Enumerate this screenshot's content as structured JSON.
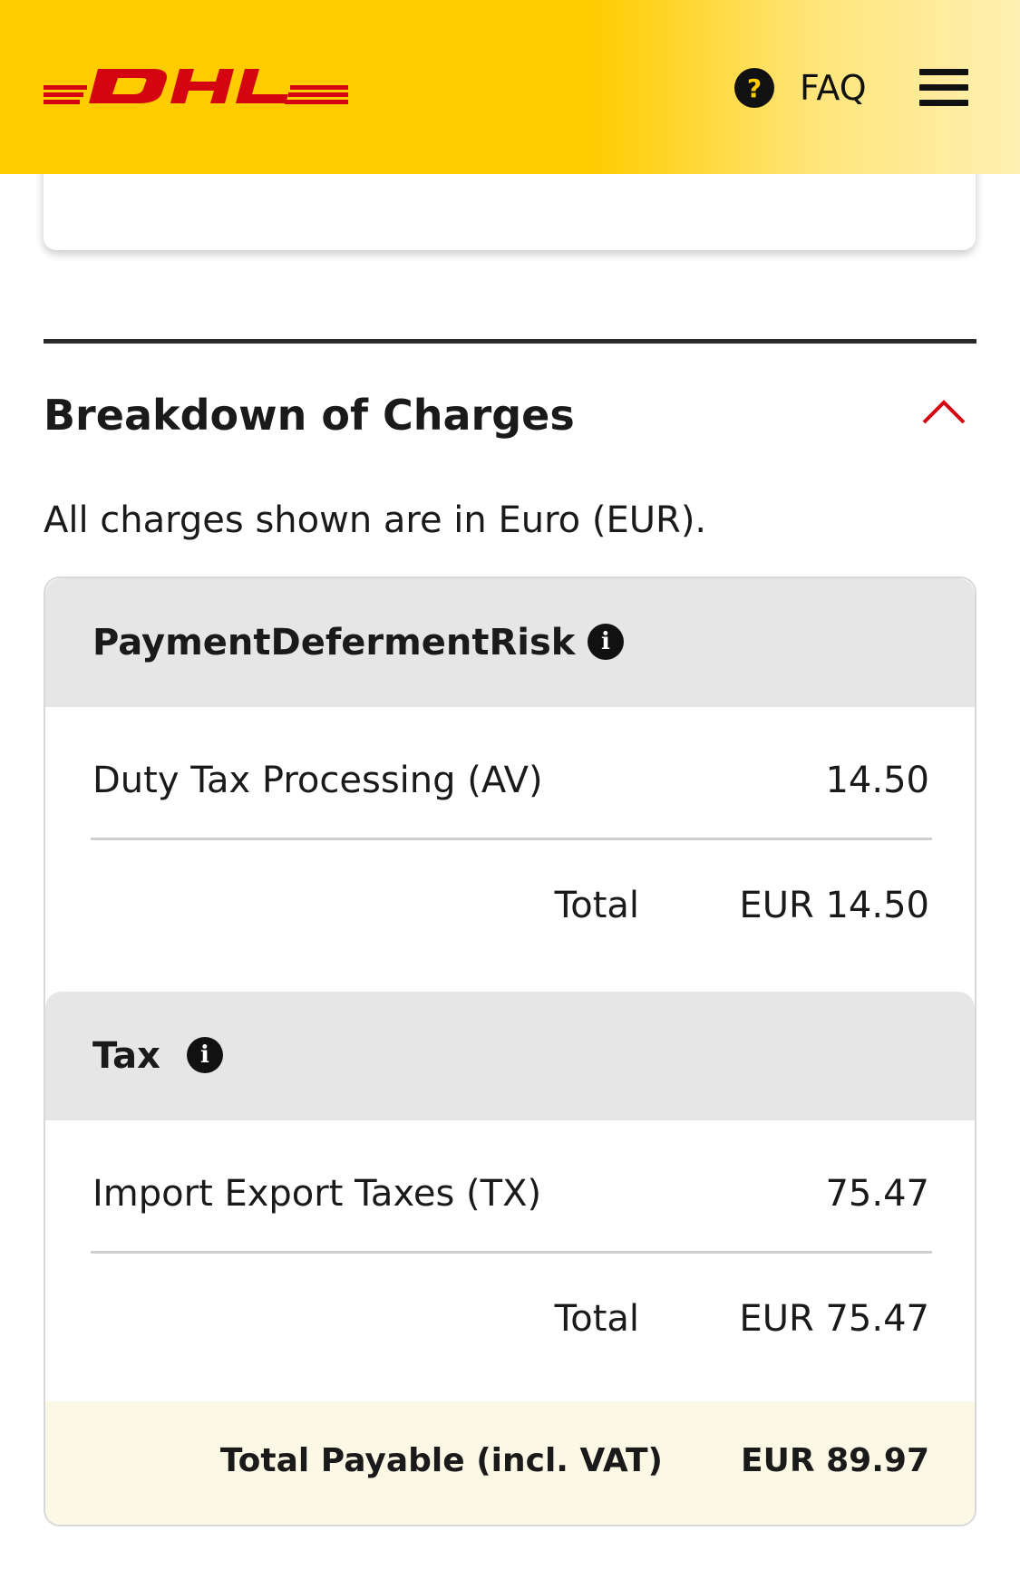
{
  "header": {
    "brand": "DHL",
    "faq_label": "FAQ",
    "faq_icon": "question-circle-icon",
    "menu_icon": "hamburger-menu-icon"
  },
  "colors": {
    "brand_yellow": "#ffcc00",
    "brand_red": "#d40511",
    "text": "#1a1a1a",
    "group_header_bg": "#e6e6e6",
    "payable_bg": "#fcf8e6"
  },
  "section": {
    "title": "Breakdown of Charges",
    "toggle_icon": "chevron-up-icon",
    "subtitle": "All charges shown are in Euro (EUR)."
  },
  "groups": [
    {
      "title": "PaymentDefermentRisk",
      "info_icon": "info-icon",
      "items": [
        {
          "label": "Duty Tax Processing (AV)",
          "value": "14.50"
        }
      ],
      "total_label": "Total",
      "total_value": "EUR 14.50"
    },
    {
      "title": "Tax",
      "info_icon": "info-icon",
      "items": [
        {
          "label": "Import Export Taxes (TX)",
          "value": "75.47"
        }
      ],
      "total_label": "Total",
      "total_value": "EUR 75.47"
    }
  ],
  "payable": {
    "label": "Total Payable (incl. VAT)",
    "value": "EUR 89.97"
  }
}
